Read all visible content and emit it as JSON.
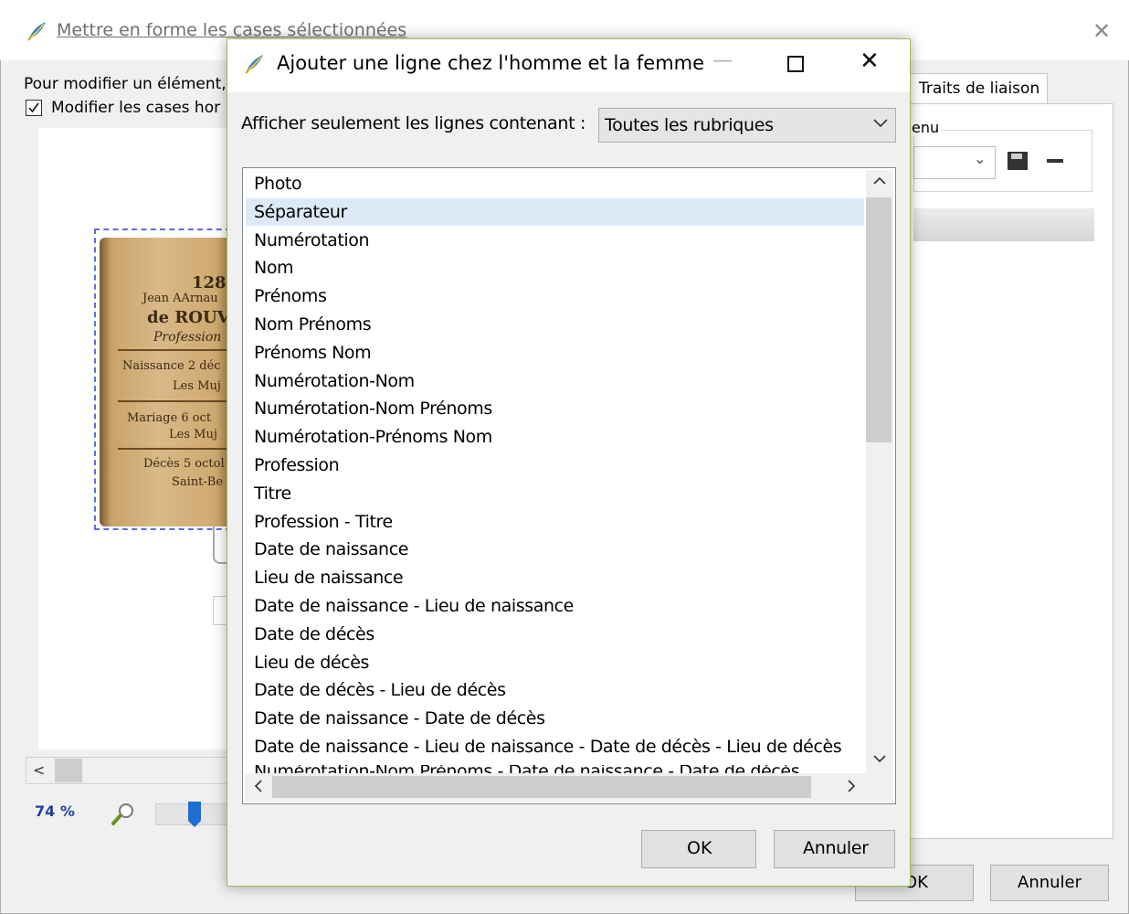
{
  "background_window": {
    "title": "Mettre en forme les cases sélectionnées",
    "instruction": "Pour modifier un élément,",
    "checkbox_label": "Modifier les cases hor",
    "checkbox_checked": true,
    "tab_label": "Traits de liaison",
    "group_label": "enu",
    "zoom_level": "74 %",
    "ok_label": "OK",
    "cancel_label": "Annuler",
    "preview_card": {
      "number": "128",
      "name_line": "Jean AArnau",
      "surname": "de ROUV",
      "profession": "Profession",
      "birth": "Naissance 2 déc",
      "birth_place": "Les Muj",
      "marriage": "Mariage 6 oct",
      "marriage_place": "Les Muj",
      "death": "Décès 5 octol",
      "death_place": "Saint-Be"
    }
  },
  "dialog": {
    "title": "Ajouter une ligne chez l'homme et la femme",
    "filter_label": "Afficher seulement les lignes contenant :",
    "filter_value": "Toutes les rubriques",
    "items": [
      "Photo",
      "Séparateur",
      "Numérotation",
      "Nom",
      "Prénoms",
      "Nom Prénoms",
      "Prénoms Nom",
      "Numérotation-Nom",
      "Numérotation-Nom Prénoms",
      "Numérotation-Prénoms Nom",
      "Profession",
      "Titre",
      "Profession - Titre",
      "Date de naissance",
      "Lieu de naissance",
      "Date de naissance - Lieu de naissance",
      "Date de décès",
      "Lieu de décès",
      "Date de décès - Lieu de décès",
      "Date de naissance - Date de décès",
      "Date de naissance - Lieu de naissance - Date de décès - Lieu de décès"
    ],
    "partial_item": "Numérotation-Nom Prénoms - Date de naissance - Date de décès",
    "selected_item": "Séparateur",
    "ok_label": "OK",
    "cancel_label": "Annuler"
  },
  "colors": {
    "dialog_border": "#9bbb59",
    "selection": "#dde9f6",
    "zoom_text": "#1f3fa0",
    "focus_dash": "#5b6fd6"
  },
  "icons": {
    "app": "quill-feather-icon",
    "zoom": "magnifier-icon",
    "save": "floppy-disk-icon",
    "remove": "minus-icon"
  }
}
